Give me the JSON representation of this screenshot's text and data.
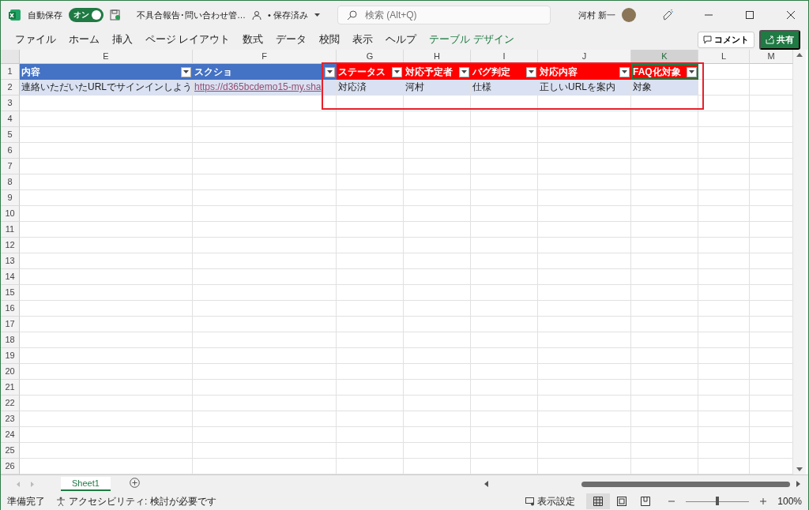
{
  "title_bar": {
    "autosave_label": "自動保存",
    "autosave": {
      "label": "オン",
      "on": true
    },
    "file_name": "不具合報告･問い合わせ管…",
    "save_status": "• 保存済み",
    "search": {
      "placeholder": "検索 (Alt+Q)"
    },
    "user_name": "河村 新一"
  },
  "ribbon_tabs": [
    {
      "label": "ファイル",
      "kind": "normal"
    },
    {
      "label": "ホーム",
      "kind": "normal"
    },
    {
      "label": "挿入",
      "kind": "normal"
    },
    {
      "label": "ページ レイアウト",
      "kind": "normal"
    },
    {
      "label": "数式",
      "kind": "normal"
    },
    {
      "label": "データ",
      "kind": "normal"
    },
    {
      "label": "校閲",
      "kind": "normal"
    },
    {
      "label": "表示",
      "kind": "normal"
    },
    {
      "label": "ヘルプ",
      "kind": "normal"
    },
    {
      "label": "テーブル デザイン",
      "kind": "contextual"
    }
  ],
  "ribbon_buttons": {
    "comment": "コメント",
    "share": "共有"
  },
  "columns": [
    {
      "letter": "E",
      "selected": false
    },
    {
      "letter": "F",
      "selected": false
    },
    {
      "letter": "G",
      "selected": false
    },
    {
      "letter": "H",
      "selected": false
    },
    {
      "letter": "I",
      "selected": false
    },
    {
      "letter": "J",
      "selected": false
    },
    {
      "letter": "K",
      "selected": true
    },
    {
      "letter": "L",
      "selected": false
    },
    {
      "letter": "M",
      "selected": false
    }
  ],
  "row_numbers": [
    "1",
    "2",
    "3",
    "4",
    "5",
    "6",
    "7",
    "8",
    "9",
    "10",
    "11",
    "12",
    "13",
    "14",
    "15",
    "16",
    "17",
    "18",
    "19",
    "20",
    "21",
    "22",
    "23",
    "24",
    "25",
    "26"
  ],
  "table": {
    "headers": [
      {
        "label": "内容",
        "color": "#4472c4",
        "selected": false
      },
      {
        "label": "スクショ",
        "color": "#4472c4",
        "selected": false
      },
      {
        "label": "ステータス",
        "color": "#ff0000",
        "selected": false
      },
      {
        "label": "対応予定者",
        "color": "#ff0000",
        "selected": false
      },
      {
        "label": "バグ判定",
        "color": "#ff0000",
        "selected": false
      },
      {
        "label": "対応内容",
        "color": "#ff0000",
        "selected": false
      },
      {
        "label": "FAQ化対象",
        "color": "#ff0000",
        "selected": true
      }
    ],
    "rows": [
      [
        {
          "text": "連絡いただいたURLでサインインしよう",
          "kind": "text"
        },
        {
          "text": "https://d365bcdemo15-my.sha",
          "kind": "link"
        },
        {
          "text": "対応済",
          "kind": "text"
        },
        {
          "text": "河村",
          "kind": "text"
        },
        {
          "text": "仕様",
          "kind": "text"
        },
        {
          "text": "正しいURLを案内",
          "kind": "text"
        },
        {
          "text": "対象",
          "kind": "text"
        }
      ]
    ]
  },
  "annotations": [
    {
      "kind": "rectangle"
    }
  ],
  "sheet_tabs": [
    {
      "label": "Sheet1",
      "selected": true
    }
  ],
  "status_bar": {
    "ready": "準備完了",
    "accessibility": "アクセシビリティ: 検討が必要です",
    "display_settings": "表示設定",
    "views": [
      {
        "kind": "normal",
        "selected": true
      },
      {
        "kind": "page-layout",
        "selected": false
      },
      {
        "kind": "page-break",
        "selected": false
      }
    ],
    "zoom": {
      "level": 0.5
    },
    "zoom_label": "100%"
  }
}
